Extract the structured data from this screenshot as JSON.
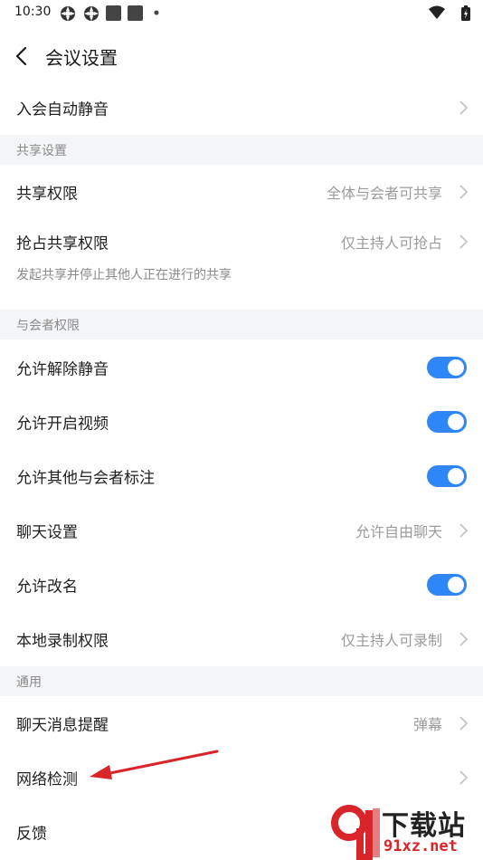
{
  "status_bar": {
    "time": "10:30"
  },
  "header": {
    "title": "会议设置"
  },
  "rows": {
    "auto_mute": {
      "label": "入会自动静音"
    },
    "share_permission": {
      "label": "共享权限",
      "value": "全体与会者可共享"
    },
    "grab_share": {
      "label": "抢占共享权限",
      "value": "仅主持人可抢占",
      "hint": "发起共享并停止其他人正在进行的共享"
    },
    "allow_unmute": {
      "label": "允许解除静音",
      "on": true
    },
    "allow_video": {
      "label": "允许开启视频",
      "on": true
    },
    "allow_annotate": {
      "label": "允许其他与会者标注",
      "on": true
    },
    "chat_settings": {
      "label": "聊天设置",
      "value": "允许自由聊天"
    },
    "allow_rename": {
      "label": "允许改名",
      "on": true
    },
    "local_record": {
      "label": "本地录制权限",
      "value": "仅主持人可录制"
    },
    "chat_notify": {
      "label": "聊天消息提醒",
      "value": "弹幕"
    },
    "network_check": {
      "label": "网络检测"
    },
    "feedback": {
      "label": "反馈"
    }
  },
  "sections": {
    "share": "共享设置",
    "attendee": "与会者权限",
    "general": "通用"
  },
  "watermark": {
    "text": "下载站",
    "url": "91xz.net"
  },
  "colors": {
    "accent": "#2f86f6",
    "annotation": "#d9252a"
  }
}
